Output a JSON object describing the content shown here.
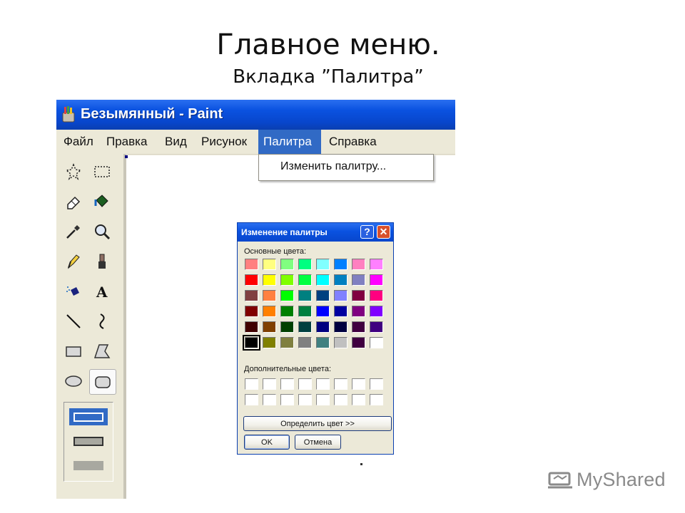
{
  "slide": {
    "title": "Главное меню.",
    "subtitle": "Вкладка ”Палитра”"
  },
  "paint_window": {
    "title": "Безымянный - Paint",
    "menu": [
      "Файл",
      "Правка",
      "Вид",
      "Рисунок",
      "Палитра",
      "Справка"
    ],
    "active_menu": "Палитра",
    "dropdown_item": "Изменить палитру...",
    "tools": [
      {
        "name": "free-form-select-icon",
        "selected": false
      },
      {
        "name": "rect-select-icon",
        "selected": false
      },
      {
        "name": "eraser-icon",
        "selected": false
      },
      {
        "name": "fill-bucket-icon",
        "selected": false
      },
      {
        "name": "color-picker-icon",
        "selected": false
      },
      {
        "name": "magnifier-icon",
        "selected": false
      },
      {
        "name": "pencil-icon",
        "selected": false
      },
      {
        "name": "brush-icon",
        "selected": false
      },
      {
        "name": "airbrush-icon",
        "selected": false
      },
      {
        "name": "text-icon",
        "selected": false
      },
      {
        "name": "line-icon",
        "selected": false
      },
      {
        "name": "curve-icon",
        "selected": false
      },
      {
        "name": "rectangle-icon",
        "selected": false
      },
      {
        "name": "polygon-icon",
        "selected": false
      },
      {
        "name": "ellipse-icon",
        "selected": false
      },
      {
        "name": "rounded-rect-icon",
        "selected": true
      }
    ],
    "text_tool_label": "A",
    "fill_options": [
      "outline",
      "outline-and-fill",
      "fill-only"
    ],
    "fill_option_selected": "outline"
  },
  "dialog": {
    "title": "Изменение палитры",
    "help_label": "?",
    "close_label": "✕",
    "basic_colors_label": "Основные цвета:",
    "custom_colors_label": "Дополнительные цвета:",
    "define_button": "Определить цвет >>",
    "ok_button": "OK",
    "cancel_button": "Отмена",
    "basic_colors": [
      [
        "#ff8080",
        "#ffff80",
        "#80ff80",
        "#00ff80",
        "#80ffff",
        "#0080ff",
        "#ff80c0",
        "#ff80ff"
      ],
      [
        "#ff0000",
        "#ffff00",
        "#80ff00",
        "#00ff40",
        "#00ffff",
        "#0080c0",
        "#8080c0",
        "#ff00ff"
      ],
      [
        "#804040",
        "#ff8040",
        "#00ff00",
        "#008080",
        "#004080",
        "#8080ff",
        "#800040",
        "#ff0080"
      ],
      [
        "#800000",
        "#ff8000",
        "#008000",
        "#008040",
        "#0000ff",
        "#0000a0",
        "#800080",
        "#8000ff"
      ],
      [
        "#400000",
        "#804000",
        "#004000",
        "#004040",
        "#000080",
        "#000040",
        "#400040",
        "#400080"
      ],
      [
        "#000000",
        "#808000",
        "#808040",
        "#808080",
        "#408080",
        "#c0c0c0",
        "#400040",
        "#ffffff"
      ]
    ],
    "selected_color": "#000000"
  },
  "watermark": {
    "text": "MyShared"
  }
}
